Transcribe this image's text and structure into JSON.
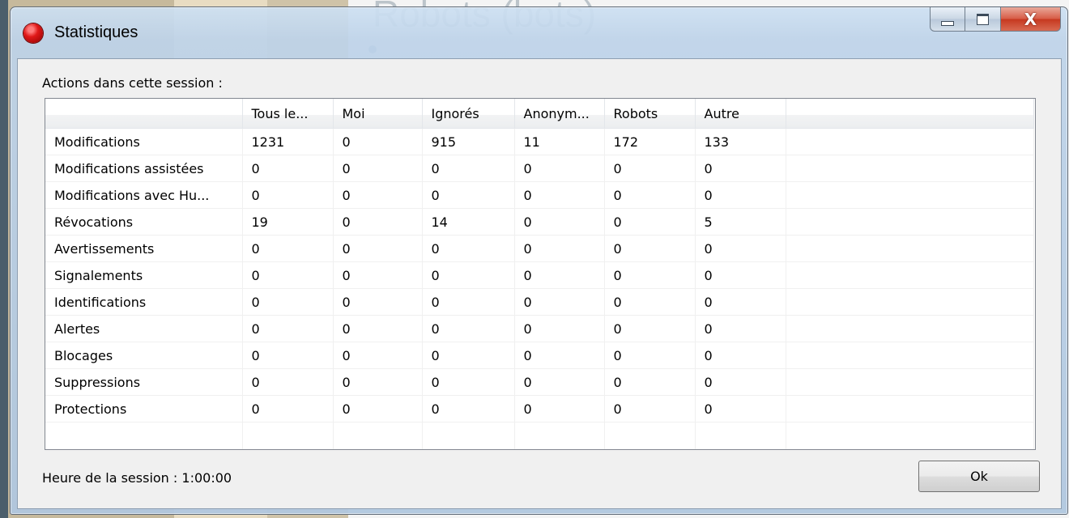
{
  "background": {
    "heading": "Robots (bots)"
  },
  "window": {
    "title": "Statistiques",
    "close_glyph": "X"
  },
  "stats": {
    "section_label": "Actions dans cette session :",
    "columns": [
      "",
      "Tous le...",
      "Moi",
      "Ignorés",
      "Anonym...",
      "Robots",
      "Autre",
      ""
    ],
    "rows": [
      {
        "label": "Modifications",
        "values": [
          "1231",
          "0",
          "915",
          "11",
          "172",
          "133"
        ]
      },
      {
        "label": "Modifications assistées",
        "values": [
          "0",
          "0",
          "0",
          "0",
          "0",
          "0"
        ]
      },
      {
        "label": "Modifications avec Hu...",
        "values": [
          "0",
          "0",
          "0",
          "0",
          "0",
          "0"
        ]
      },
      {
        "label": "Révocations",
        "values": [
          "19",
          "0",
          "14",
          "0",
          "0",
          "5"
        ]
      },
      {
        "label": "Avertissements",
        "values": [
          "0",
          "0",
          "0",
          "0",
          "0",
          "0"
        ]
      },
      {
        "label": "Signalements",
        "values": [
          "0",
          "0",
          "0",
          "0",
          "0",
          "0"
        ]
      },
      {
        "label": "Identifications",
        "values": [
          "0",
          "0",
          "0",
          "0",
          "0",
          "0"
        ]
      },
      {
        "label": "Alertes",
        "values": [
          "0",
          "0",
          "0",
          "0",
          "0",
          "0"
        ]
      },
      {
        "label": "Blocages",
        "values": [
          "0",
          "0",
          "0",
          "0",
          "0",
          "0"
        ]
      },
      {
        "label": "Suppressions",
        "values": [
          "0",
          "0",
          "0",
          "0",
          "0",
          "0"
        ]
      },
      {
        "label": "Protections",
        "values": [
          "0",
          "0",
          "0",
          "0",
          "0",
          "0"
        ]
      }
    ]
  },
  "footer": {
    "session_time": "Heure de la session : 1:00:00",
    "ok_label": "Ok"
  },
  "icons": {
    "app_icon": "red-circle-icon",
    "minimize": "minimize-icon",
    "maximize": "maximize-icon",
    "close": "close-icon"
  }
}
